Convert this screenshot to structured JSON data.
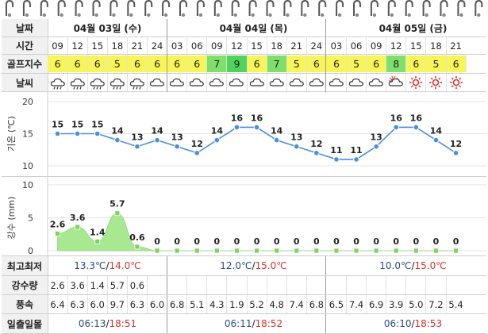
{
  "header": {
    "date_label": "날짜",
    "days": [
      "04월 03일 (수)",
      "04월 04일 (목)",
      "04월 05일 (금)"
    ]
  },
  "rows": {
    "time": {
      "label": "시간",
      "values": [
        "09",
        "12",
        "15",
        "18",
        "21",
        "24",
        "03",
        "06",
        "09",
        "12",
        "15",
        "18",
        "21",
        "24",
        "03",
        "06",
        "09",
        "12",
        "15",
        "18",
        "21"
      ]
    },
    "golf": {
      "label": "골프지수",
      "values": [
        6,
        6,
        6,
        5,
        6,
        6,
        6,
        6,
        7,
        9,
        6,
        7,
        5,
        6,
        6,
        5,
        6,
        8,
        6,
        5,
        6
      ]
    },
    "weather": {
      "label": "날씨",
      "icons": [
        "cloud-rain-icon",
        "cloud-rain-icon",
        "cloud-rain-icon",
        "cloud-rain-icon",
        "cloud-rain-icon",
        "cloud-icon",
        "cloud-icon",
        "cloud-icon",
        "cloud-icon",
        "cloud-icon",
        "cloud-icon",
        "cloud-icon",
        "cloud-icon",
        "cloud-icon",
        "cloud-icon",
        "cloud-icon",
        "cloud-icon",
        "sun-cloud-icon",
        "sun-icon",
        "sun-icon",
        "sun-icon"
      ]
    },
    "minmax": {
      "label": "최고최저",
      "values": [
        {
          "min": "13.3℃",
          "max": "14.0℃"
        },
        {
          "min": "12.0℃",
          "max": "15.0℃"
        },
        {
          "min": "10.0℃",
          "max": "15.0℃"
        }
      ]
    },
    "rain": {
      "label": "강수량",
      "values": [
        "2.6",
        "3.6",
        "1.4",
        "5.7",
        "0.6",
        "",
        "",
        "",
        "",
        "",
        "",
        "",
        "",
        "",
        "",
        "",
        "",
        "",
        "",
        "",
        ""
      ]
    },
    "wind": {
      "label": "풍속",
      "values": [
        "6.4",
        "6.3",
        "6.0",
        "9.7",
        "6.3",
        "6.0",
        "6.8",
        "5.1",
        "4.3",
        "1.9",
        "5.2",
        "4.8",
        "7.4",
        "6.8",
        "6.5",
        "7.4",
        "6.9",
        "3.9",
        "5.0",
        "7.2",
        "5.4"
      ]
    },
    "sun": {
      "label": "일출일몰",
      "values": [
        {
          "rise": "06:13",
          "set": "18:51"
        },
        {
          "rise": "06:11",
          "set": "18:52"
        },
        {
          "rise": "06:10",
          "set": "18:53"
        }
      ]
    }
  },
  "colors": {
    "golf_yellow": "#f7f55a",
    "golf_green": "#7ee06a",
    "golf_bright": "#4fd45a",
    "temp_line": "#4a90d9",
    "rain_fill": "#a8e890",
    "rain_marker": "#7cd45a",
    "sunset_red": "#d8332a",
    "sunrise_blue": "#2a4b8a"
  },
  "chart_data": [
    {
      "type": "line",
      "ylabel": "기온 (℃)",
      "ylim": [
        10,
        20
      ],
      "yticks": [
        10,
        15,
        20
      ],
      "values": [
        15,
        15,
        15,
        14,
        13,
        14,
        13,
        12,
        14,
        16,
        16,
        14,
        13,
        12,
        11,
        11,
        13,
        16,
        16,
        14,
        12
      ]
    },
    {
      "type": "area",
      "ylabel": "강수 (mm)",
      "ylim": [
        0,
        10
      ],
      "yticks": [
        0,
        5,
        10
      ],
      "values": [
        2.6,
        3.6,
        1.4,
        5.7,
        0.6,
        0,
        0,
        0,
        0,
        0,
        0,
        0,
        0,
        0,
        0,
        0,
        0,
        0,
        0,
        0,
        0
      ]
    }
  ]
}
